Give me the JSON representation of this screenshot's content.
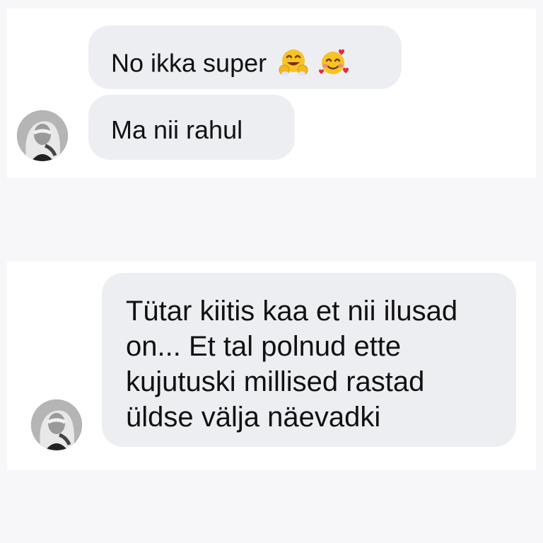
{
  "messages": [
    {
      "text": "No ikka super",
      "emojis": [
        "hugging-face-icon",
        "smiling-face-with-hearts-icon"
      ]
    },
    {
      "text": "Ma nii rahul"
    },
    {
      "lines": [
        "Tütar kiitis kaa et nii ilusad",
        "on... Et tal polnud ette",
        "kujutuski millised rastad",
        "üldse välja näevadki"
      ]
    }
  ],
  "colors": {
    "background": "#f7f7f9",
    "panel": "#ffffff",
    "bubble": "#edeef2",
    "text": "#111111"
  }
}
